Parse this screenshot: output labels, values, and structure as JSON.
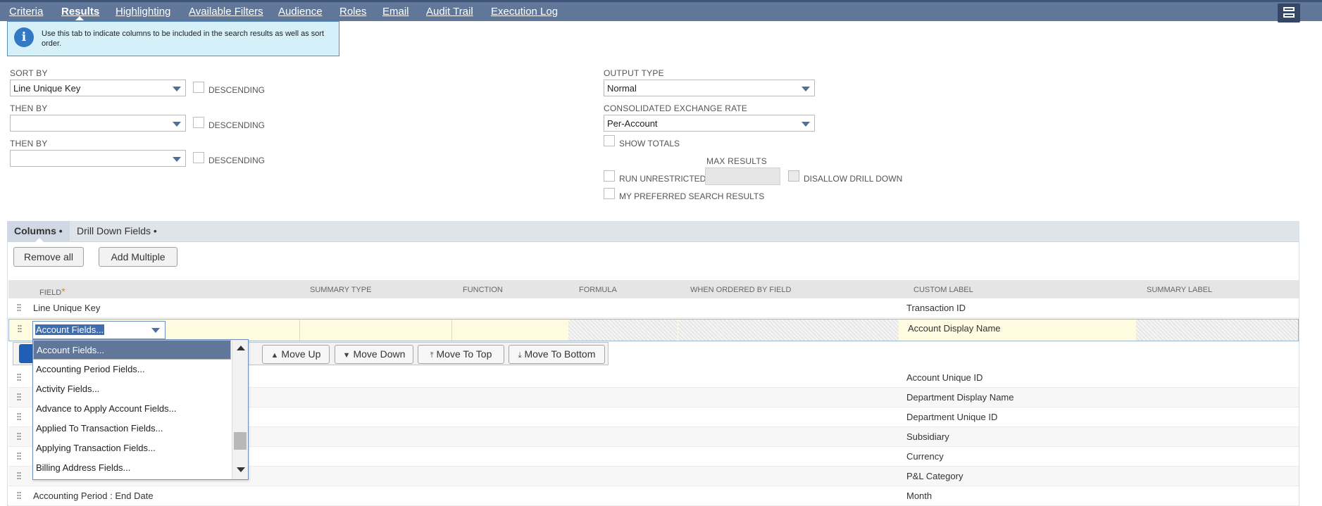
{
  "top_tabs": [
    "Criteria",
    "Results",
    "Highlighting",
    "Available Filters",
    "Audience",
    "Roles",
    "Email",
    "Audit Trail",
    "Execution Log"
  ],
  "active_tab": "Results",
  "info_text": "Use this tab to indicate columns to be included in the search results as well as sort order.",
  "sort": {
    "sort_by_label": "SORT BY",
    "sort_by_value": "Line Unique Key",
    "then_by_label": "THEN BY",
    "then_by_1_value": "",
    "then_by_2_value": "",
    "descending_label": "DESCENDING"
  },
  "output": {
    "output_type_label": "OUTPUT TYPE",
    "output_type_value": "Normal",
    "exchange_rate_label": "CONSOLIDATED EXCHANGE RATE",
    "exchange_rate_value": "Per-Account",
    "show_totals_label": "SHOW TOTALS",
    "max_results_label": "MAX RESULTS",
    "run_unrestricted_label": "RUN UNRESTRICTED",
    "disallow_drill_down_label": "DISALLOW DRILL DOWN",
    "my_preferred_label": "MY PREFERRED SEARCH RESULTS"
  },
  "subtabs": [
    "Columns •",
    "Drill Down Fields •"
  ],
  "buttons": {
    "remove_all": "Remove all",
    "add_multiple": "Add Multiple"
  },
  "columns": {
    "field": "FIELD",
    "required_mark": "*",
    "summary_type": "SUMMARY TYPE",
    "function": "FUNCTION",
    "formula": "FORMULA",
    "when_ordered_by_field": "WHEN ORDERED BY FIELD",
    "custom_label": "CUSTOM LABEL",
    "summary_label": "SUMMARY LABEL"
  },
  "row_first": {
    "field": "Line Unique Key",
    "custom_label": "Transaction ID"
  },
  "edit_row": {
    "field": "Account Fields...",
    "custom_label": "Account Display Name"
  },
  "action_buttons": [
    "Move Up",
    "Move Down",
    "Move To Top",
    "Move To Bottom"
  ],
  "rows": [
    {
      "field": "",
      "custom_label": "Account Unique ID"
    },
    {
      "field": "",
      "custom_label": "Department Display Name"
    },
    {
      "field": "",
      "custom_label": "Department Unique ID"
    },
    {
      "field": "",
      "custom_label": "Subsidiary"
    },
    {
      "field": "",
      "custom_label": "Currency"
    },
    {
      "field": "",
      "custom_label": "P&L Category"
    },
    {
      "field": "Accounting Period : End Date",
      "custom_label": "Month"
    }
  ],
  "dropdown_options": [
    "Account Fields...",
    "Accounting Period Fields...",
    "Activity Fields...",
    "Advance to Apply Account Fields...",
    "Applied To Transaction Fields...",
    "Applying Transaction Fields...",
    "Billing Address Fields..."
  ],
  "dropdown_selected": "Account Fields..."
}
